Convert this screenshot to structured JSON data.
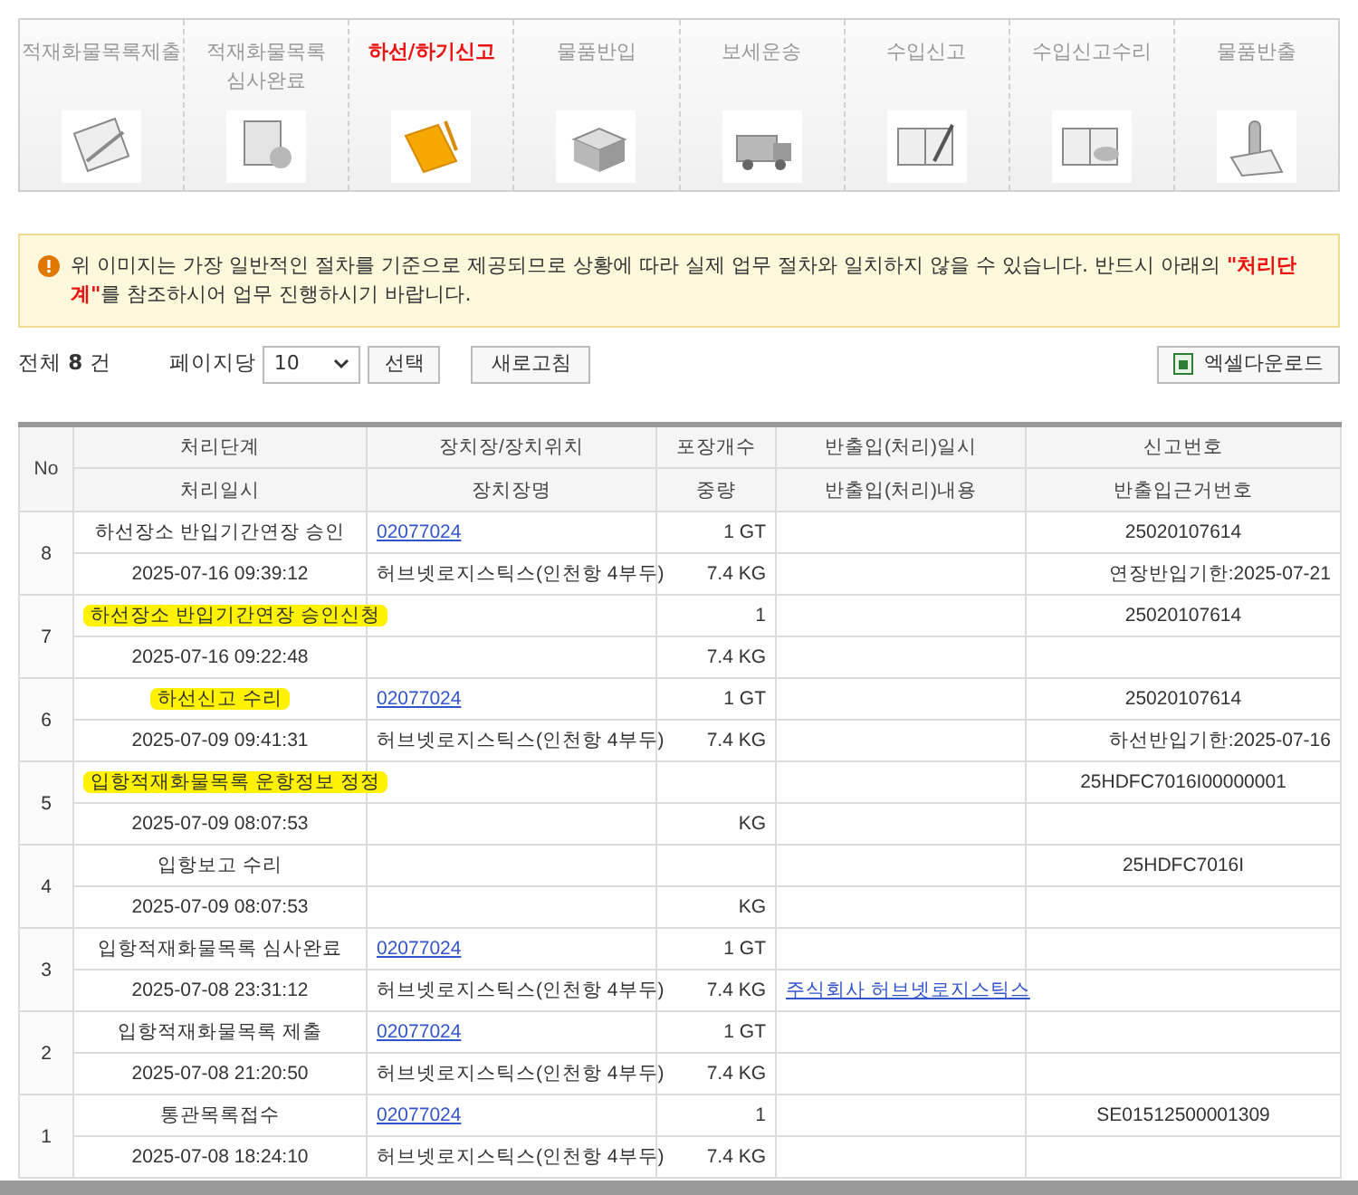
{
  "steps": [
    {
      "label": "적재화물목록제출",
      "selected": false
    },
    {
      "label": "적재화물목록\n심사완료",
      "selected": false
    },
    {
      "label": "하선/하기신고",
      "selected": true
    },
    {
      "label": "물품반입",
      "selected": false
    },
    {
      "label": "보세운송",
      "selected": false
    },
    {
      "label": "수입신고",
      "selected": false
    },
    {
      "label": "수입신고수리",
      "selected": false
    },
    {
      "label": "물품반출",
      "selected": false
    }
  ],
  "notice": "위 이미지는 가장 일반적인 절차를 기준으로 제공되므로 상황에 따라 실제 업무 절차와 일치하지 않을 수 있습니다. 반드시 아래의 **\"처리단계\"**를 참조하시어 업무 진행하시기 바랍니다.",
  "toolbar": {
    "total_label": "전체",
    "total_count": "8",
    "total_unit": "건",
    "per_page_label": "페이지당",
    "per_page_value": "10",
    "select_button": "선택",
    "refresh_button": "새로고침",
    "excel_button": "엑셀다운로드"
  },
  "table": {
    "no_header": "No",
    "columns_top": [
      "처리단계",
      "장치장/장치위치",
      "포장개수",
      "반출입(처리)일시",
      "신고번호"
    ],
    "columns_bottom": [
      "처리일시",
      "장치장명",
      "중량",
      "반출입(처리)내용",
      "반출입근거번호"
    ],
    "rows": [
      {
        "no": "8",
        "step": "하선장소 반입기간연장 승인",
        "highlighted": false,
        "date": "2025-07-16 09:39:12",
        "warehouse_code": "02077024",
        "warehouse_name": "허브넷로지스틱스(인천항 4부두)",
        "packages": "1 GT",
        "weight": "7.4 KG",
        "report_no": "25020107614",
        "basis_no": "연장반입기한:2025-07-21"
      },
      {
        "no": "7",
        "step": "하선장소 반입기간연장 승인신청",
        "highlighted": true,
        "date": "2025-07-16 09:22:48",
        "packages": "1",
        "weight": "7.4 KG",
        "report_no": "25020107614"
      },
      {
        "no": "6",
        "step": "하선신고 수리",
        "highlighted": true,
        "date": "2025-07-09 09:41:31",
        "warehouse_code": "02077024",
        "warehouse_name": "허브넷로지스틱스(인천항 4부두)",
        "packages": "1 GT",
        "weight": "7.4 KG",
        "report_no": "25020107614",
        "basis_no": "하선반입기한:2025-07-16"
      },
      {
        "no": "5",
        "step": "입항적재화물목록 운항정보 정정",
        "highlighted": true,
        "date": "2025-07-09 08:07:53",
        "weight": "KG",
        "report_no": "25HDFC7016I00000001"
      },
      {
        "no": "4",
        "step": "입항보고 수리",
        "highlighted": false,
        "date": "2025-07-09 08:07:53",
        "weight": "KG",
        "report_no": "25HDFC7016I"
      },
      {
        "no": "3",
        "step": "입항적재화물목록 심사완료",
        "highlighted": false,
        "date": "2025-07-08 23:31:12",
        "warehouse_code": "02077024",
        "warehouse_name": "허브넷로지스틱스(인천항 4부두)",
        "packages": "1 GT",
        "weight": "7.4 KG",
        "inout_content": "주식회사 허브넷로지스틱스"
      },
      {
        "no": "2",
        "step": "입항적재화물목록 제출",
        "highlighted": false,
        "date": "2025-07-08 21:20:50",
        "warehouse_code": "02077024",
        "warehouse_name": "허브넷로지스틱스(인천항 4부두)",
        "packages": "1 GT",
        "weight": "7.4 KG"
      },
      {
        "no": "1",
        "step": "통관목록접수",
        "highlighted": false,
        "date": "2025-07-08 18:24:10",
        "warehouse_code": "02077024",
        "warehouse_name": "허브넷로지스틱스(인천항 4부두)",
        "packages": "1",
        "weight": "7.4 KG",
        "report_no": "SE01512500001309"
      }
    ]
  }
}
